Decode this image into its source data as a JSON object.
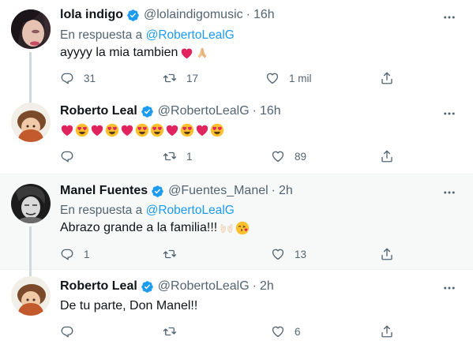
{
  "tweets": [
    {
      "name": "lola indigo",
      "handle": "@lolaindigomusic",
      "time": "16h",
      "reply_prefix": "En respuesta a",
      "reply_mention": "@RobertoLealG",
      "text": "ayyyy la mia tambien",
      "emojis": [
        "red-heart",
        "folded-hands"
      ],
      "replies": "31",
      "retweets": "17",
      "likes": "1 mil"
    },
    {
      "name": "Roberto Leal",
      "handle": "@RobertoLealG",
      "time": "16h",
      "text": "",
      "emojis": [
        "red-heart",
        "heart-eyes",
        "red-heart",
        "heart-eyes",
        "red-heart",
        "heart-eyes",
        "heart-eyes",
        "red-heart",
        "heart-eyes",
        "red-heart",
        "heart-eyes"
      ],
      "replies": "",
      "retweets": "1",
      "likes": "89"
    },
    {
      "name": "Manel Fuentes",
      "handle": "@Fuentes_Manel",
      "time": "2h",
      "reply_prefix": "En respuesta a",
      "reply_mention": "@RobertoLealG",
      "text": "Abrazo grande a la familia!!!",
      "emojis": [
        "raised-hands",
        "face-blowing-kiss"
      ],
      "replies": "1",
      "retweets": "",
      "likes": "13"
    },
    {
      "name": "Roberto Leal",
      "handle": "@RobertoLealG",
      "time": "2h",
      "text": "De tu parte, Don Manel!!",
      "emojis": [],
      "replies": "",
      "retweets": "",
      "likes": "6"
    }
  ],
  "separator": "·",
  "colors": {
    "accent": "#1d9bf0",
    "secondary_text": "#536471",
    "highlight_bg": "#f7f9f9",
    "heart_red": "#e0245e"
  },
  "icons": {
    "verified": "verified-badge-icon",
    "more": "more-dots-icon",
    "reply": "reply-icon",
    "retweet": "retweet-icon",
    "like": "like-icon",
    "share": "share-icon"
  }
}
